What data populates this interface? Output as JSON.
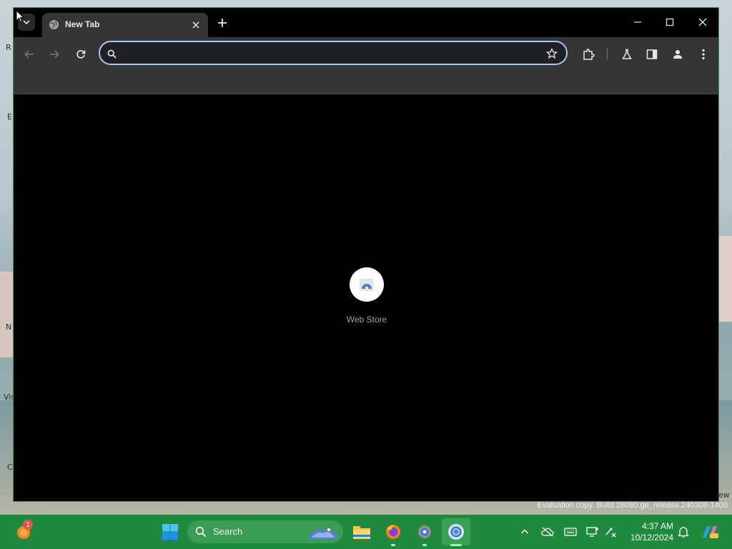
{
  "browser": {
    "tab": {
      "title": "New Tab"
    },
    "omnibox": {
      "value": "",
      "placeholder": ""
    },
    "shortcuts": [
      {
        "label": "Web Store"
      }
    ]
  },
  "desktop": {
    "edge_letters": [
      "R",
      "E",
      "N",
      "Vis",
      "C"
    ],
    "watermark": "Evaluation copy. Build 26080.ge_release.240308-1400",
    "watermark_side": "ew"
  },
  "taskbar": {
    "search_label": "Search",
    "notification_badge": "1",
    "clock": {
      "time": "4:37 AM",
      "date": "10/12/2024"
    },
    "colors": {
      "taskbar": "#1f8a3d",
      "accent": "#a8c7fa"
    },
    "apps": [
      "widgets-icon",
      "start-icon",
      "search-icon",
      "file-explorer-icon",
      "firefox-icon",
      "settings-icon",
      "chrome-icon"
    ],
    "tray": [
      "chevron-up-icon",
      "cloud-off-icon",
      "keyboard-icon",
      "display-icon",
      "network-icon",
      "bell-icon",
      "copilot-icon"
    ]
  }
}
